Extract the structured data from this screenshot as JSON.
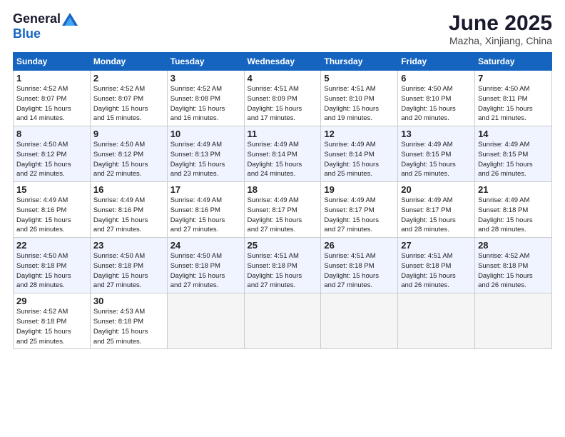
{
  "logo": {
    "general": "General",
    "blue": "Blue"
  },
  "title": "June 2025",
  "location": "Mazha, Xinjiang, China",
  "days_header": [
    "Sunday",
    "Monday",
    "Tuesday",
    "Wednesday",
    "Thursday",
    "Friday",
    "Saturday"
  ],
  "weeks": [
    [
      {
        "day": "1",
        "info": "Sunrise: 4:52 AM\nSunset: 8:07 PM\nDaylight: 15 hours\nand 14 minutes."
      },
      {
        "day": "2",
        "info": "Sunrise: 4:52 AM\nSunset: 8:07 PM\nDaylight: 15 hours\nand 15 minutes."
      },
      {
        "day": "3",
        "info": "Sunrise: 4:52 AM\nSunset: 8:08 PM\nDaylight: 15 hours\nand 16 minutes."
      },
      {
        "day": "4",
        "info": "Sunrise: 4:51 AM\nSunset: 8:09 PM\nDaylight: 15 hours\nand 17 minutes."
      },
      {
        "day": "5",
        "info": "Sunrise: 4:51 AM\nSunset: 8:10 PM\nDaylight: 15 hours\nand 19 minutes."
      },
      {
        "day": "6",
        "info": "Sunrise: 4:50 AM\nSunset: 8:10 PM\nDaylight: 15 hours\nand 20 minutes."
      },
      {
        "day": "7",
        "info": "Sunrise: 4:50 AM\nSunset: 8:11 PM\nDaylight: 15 hours\nand 21 minutes."
      }
    ],
    [
      {
        "day": "8",
        "info": "Sunrise: 4:50 AM\nSunset: 8:12 PM\nDaylight: 15 hours\nand 22 minutes."
      },
      {
        "day": "9",
        "info": "Sunrise: 4:50 AM\nSunset: 8:12 PM\nDaylight: 15 hours\nand 22 minutes."
      },
      {
        "day": "10",
        "info": "Sunrise: 4:49 AM\nSunset: 8:13 PM\nDaylight: 15 hours\nand 23 minutes."
      },
      {
        "day": "11",
        "info": "Sunrise: 4:49 AM\nSunset: 8:14 PM\nDaylight: 15 hours\nand 24 minutes."
      },
      {
        "day": "12",
        "info": "Sunrise: 4:49 AM\nSunset: 8:14 PM\nDaylight: 15 hours\nand 25 minutes."
      },
      {
        "day": "13",
        "info": "Sunrise: 4:49 AM\nSunset: 8:15 PM\nDaylight: 15 hours\nand 25 minutes."
      },
      {
        "day": "14",
        "info": "Sunrise: 4:49 AM\nSunset: 8:15 PM\nDaylight: 15 hours\nand 26 minutes."
      }
    ],
    [
      {
        "day": "15",
        "info": "Sunrise: 4:49 AM\nSunset: 8:16 PM\nDaylight: 15 hours\nand 26 minutes."
      },
      {
        "day": "16",
        "info": "Sunrise: 4:49 AM\nSunset: 8:16 PM\nDaylight: 15 hours\nand 27 minutes."
      },
      {
        "day": "17",
        "info": "Sunrise: 4:49 AM\nSunset: 8:16 PM\nDaylight: 15 hours\nand 27 minutes."
      },
      {
        "day": "18",
        "info": "Sunrise: 4:49 AM\nSunset: 8:17 PM\nDaylight: 15 hours\nand 27 minutes."
      },
      {
        "day": "19",
        "info": "Sunrise: 4:49 AM\nSunset: 8:17 PM\nDaylight: 15 hours\nand 27 minutes."
      },
      {
        "day": "20",
        "info": "Sunrise: 4:49 AM\nSunset: 8:17 PM\nDaylight: 15 hours\nand 28 minutes."
      },
      {
        "day": "21",
        "info": "Sunrise: 4:49 AM\nSunset: 8:18 PM\nDaylight: 15 hours\nand 28 minutes."
      }
    ],
    [
      {
        "day": "22",
        "info": "Sunrise: 4:50 AM\nSunset: 8:18 PM\nDaylight: 15 hours\nand 28 minutes."
      },
      {
        "day": "23",
        "info": "Sunrise: 4:50 AM\nSunset: 8:18 PM\nDaylight: 15 hours\nand 27 minutes."
      },
      {
        "day": "24",
        "info": "Sunrise: 4:50 AM\nSunset: 8:18 PM\nDaylight: 15 hours\nand 27 minutes."
      },
      {
        "day": "25",
        "info": "Sunrise: 4:51 AM\nSunset: 8:18 PM\nDaylight: 15 hours\nand 27 minutes."
      },
      {
        "day": "26",
        "info": "Sunrise: 4:51 AM\nSunset: 8:18 PM\nDaylight: 15 hours\nand 27 minutes."
      },
      {
        "day": "27",
        "info": "Sunrise: 4:51 AM\nSunset: 8:18 PM\nDaylight: 15 hours\nand 26 minutes."
      },
      {
        "day": "28",
        "info": "Sunrise: 4:52 AM\nSunset: 8:18 PM\nDaylight: 15 hours\nand 26 minutes."
      }
    ],
    [
      {
        "day": "29",
        "info": "Sunrise: 4:52 AM\nSunset: 8:18 PM\nDaylight: 15 hours\nand 25 minutes."
      },
      {
        "day": "30",
        "info": "Sunrise: 4:53 AM\nSunset: 8:18 PM\nDaylight: 15 hours\nand 25 minutes."
      },
      {
        "day": "",
        "info": ""
      },
      {
        "day": "",
        "info": ""
      },
      {
        "day": "",
        "info": ""
      },
      {
        "day": "",
        "info": ""
      },
      {
        "day": "",
        "info": ""
      }
    ]
  ]
}
